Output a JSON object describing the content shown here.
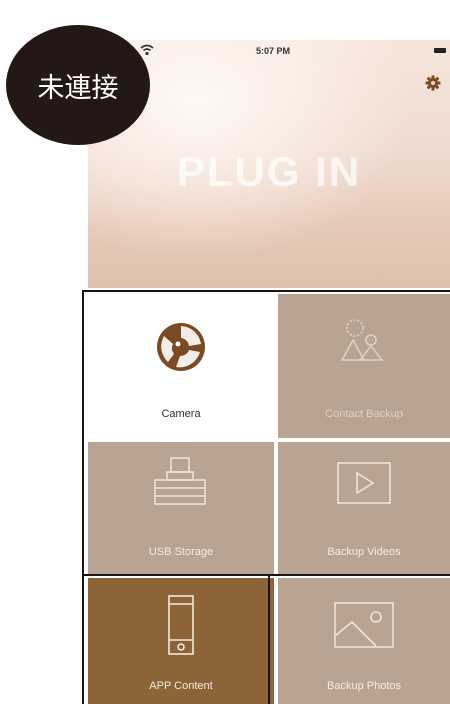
{
  "badge": {
    "text": "未連接"
  },
  "status_bar": {
    "time": "5:07 PM",
    "left_icon": "wifi-icon",
    "right_icon": "battery-icon"
  },
  "header": {
    "title": "PLUG IN",
    "settings_icon": "gear-icon"
  },
  "tiles": [
    {
      "label": "Camera",
      "icon": "camera-icon",
      "state": "active"
    },
    {
      "label": "Contact Backup",
      "icon": "contacts-icon",
      "state": "inactive"
    },
    {
      "label": "USB Storage",
      "icon": "usb-storage-icon",
      "state": "inactive"
    },
    {
      "label": "Backup Videos",
      "icon": "video-icon",
      "state": "inactive"
    },
    {
      "label": "APP Content",
      "icon": "phone-icon",
      "state": "selected"
    },
    {
      "label": "Backup Photos",
      "icon": "photo-icon",
      "state": "inactive"
    }
  ],
  "colors": {
    "tile_inactive": "#b9a392",
    "tile_selected": "#8c6438",
    "tile_active": "#ffffff",
    "camera_icon": "#7a4a22",
    "badge_bg": "#231815",
    "frame": "#151515"
  }
}
